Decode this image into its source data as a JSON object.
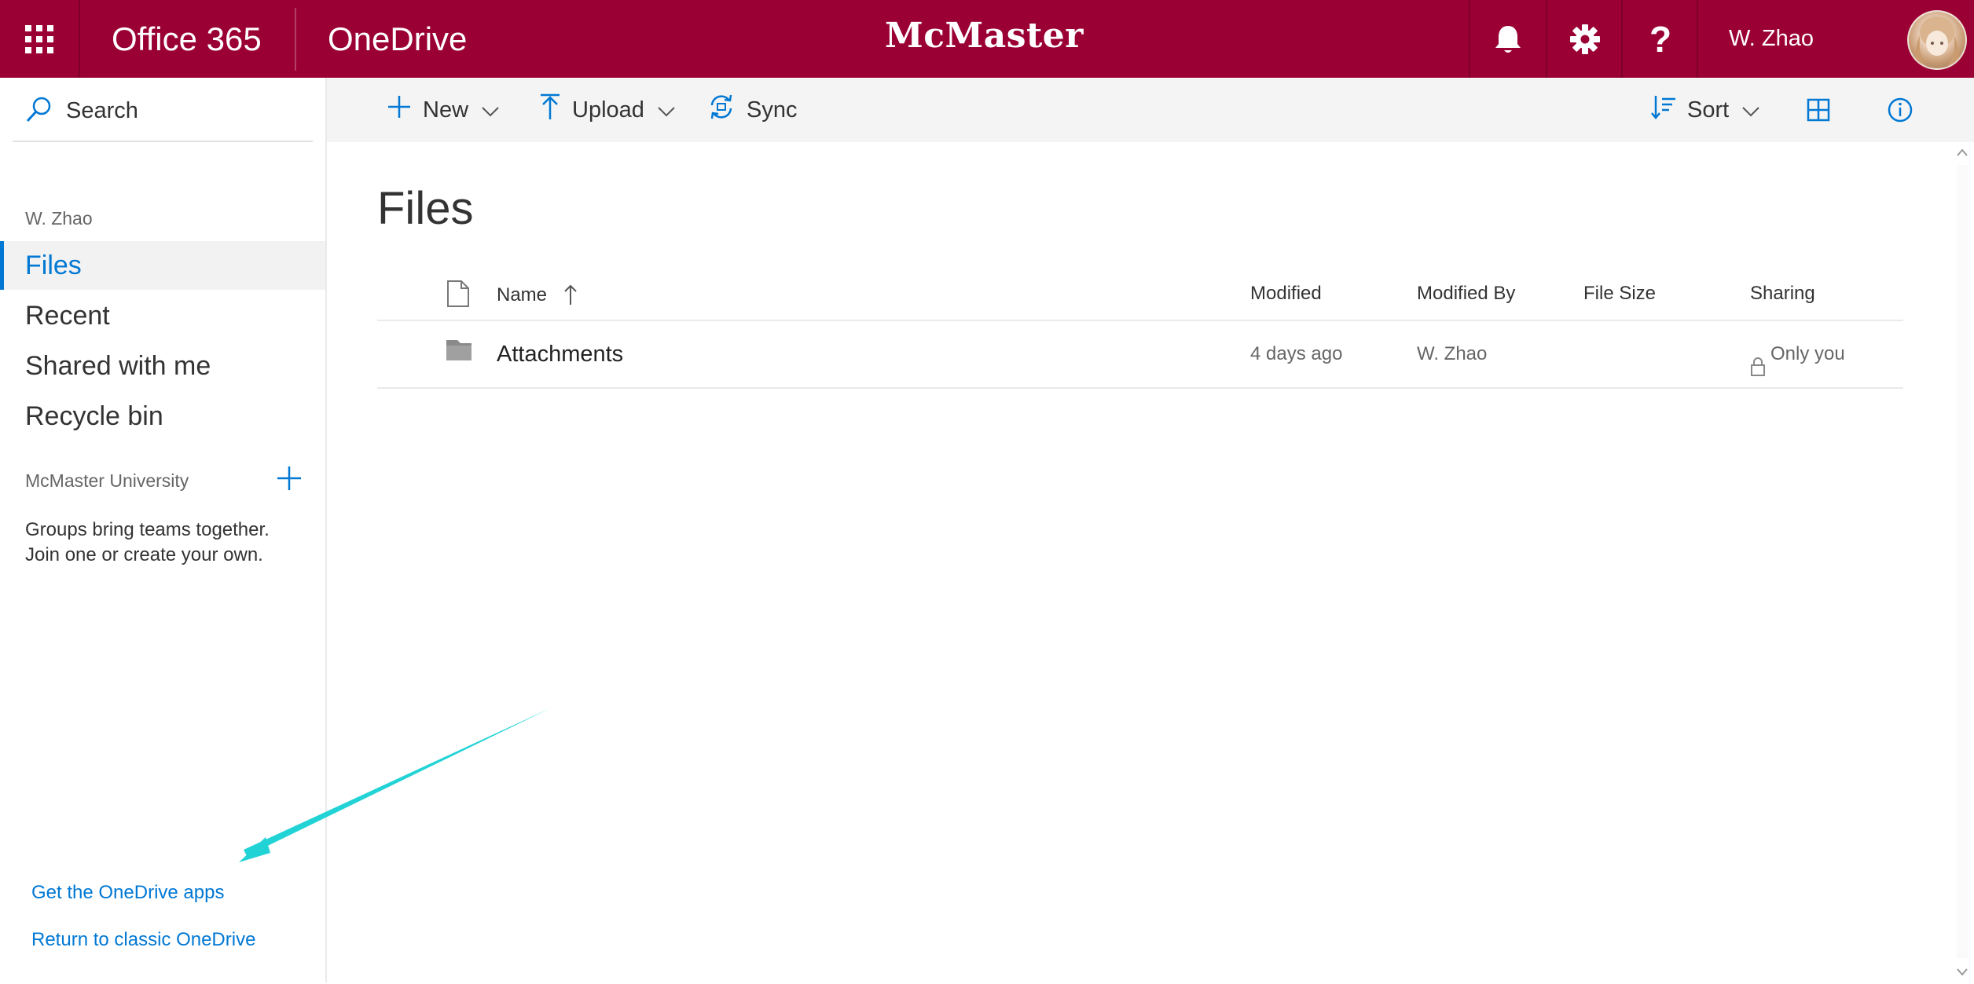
{
  "topbar": {
    "app_launcher_icon": "waffle-icon",
    "suite_name": "Office 365",
    "app_name": "OneDrive",
    "org_name": "McMaster University",
    "notifications_icon": "bell-icon",
    "settings_icon": "gear-icon",
    "help_label": "?",
    "user_name": "W. Zhao",
    "brand_color": "#9a0033"
  },
  "leftnav": {
    "search_label": "Search",
    "owner": "W. Zhao",
    "items": [
      {
        "label": "Files",
        "active": true
      },
      {
        "label": "Recent",
        "active": false
      },
      {
        "label": "Shared with me",
        "active": false
      },
      {
        "label": "Recycle bin",
        "active": false
      }
    ],
    "groups_header": "McMaster University",
    "groups_text": "Groups bring teams together. Join one or create your own.",
    "get_apps_link": "Get the OneDrive apps",
    "classic_link": "Return to classic OneDrive",
    "accent_color": "#0078d4"
  },
  "commandbar": {
    "new_label": "New",
    "upload_label": "Upload",
    "sync_label": "Sync",
    "sort_label": "Sort"
  },
  "main": {
    "title": "Files",
    "columns": {
      "name": "Name",
      "modified": "Modified",
      "modified_by": "Modified By",
      "file_size": "File Size",
      "sharing": "Sharing"
    },
    "rows": [
      {
        "icon": "folder-icon",
        "name": "Attachments",
        "modified": "4 days ago",
        "modified_by": "W. Zhao",
        "file_size": "",
        "sharing": "Only you"
      }
    ]
  },
  "annotation": {
    "arrow_color": "#22d3d6"
  }
}
